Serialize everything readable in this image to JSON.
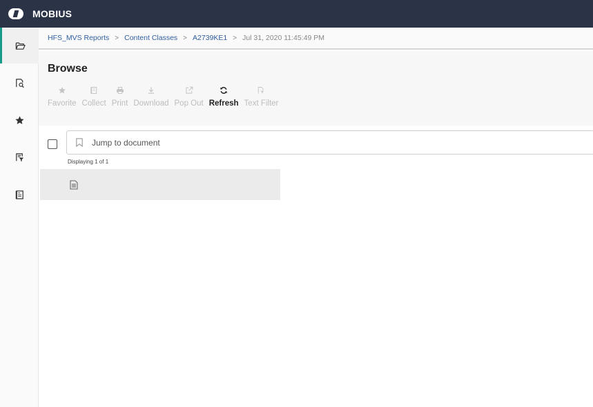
{
  "app": {
    "title": "MOBIUS"
  },
  "nav": {
    "items": [
      {
        "name": "browse",
        "icon": "folder-open-icon",
        "active": true
      },
      {
        "name": "search",
        "icon": "document-search-icon",
        "active": false
      },
      {
        "name": "favorites",
        "icon": "star-icon",
        "active": false
      },
      {
        "name": "filter",
        "icon": "document-filter-icon",
        "active": false
      },
      {
        "name": "content",
        "icon": "document-icon",
        "active": false
      }
    ]
  },
  "breadcrumb": {
    "items": [
      "HFS_MVS Reports",
      "Content Classes",
      "A2739KE1"
    ],
    "current": "Jul 31, 2020 11:45:49 PM",
    "separator": ">"
  },
  "page": {
    "title": "Browse"
  },
  "toolbar": {
    "items": [
      {
        "label": "Favorite",
        "icon": "star-icon",
        "enabled": false
      },
      {
        "label": "Collect",
        "icon": "collect-icon",
        "enabled": false
      },
      {
        "label": "Print",
        "icon": "printer-icon",
        "enabled": false
      },
      {
        "label": "Download",
        "icon": "download-icon",
        "enabled": false
      },
      {
        "label": "Pop Out",
        "icon": "pop-out-icon",
        "enabled": false
      },
      {
        "label": "Refresh",
        "icon": "refresh-icon",
        "enabled": true
      },
      {
        "label": "Text Filter",
        "icon": "text-filter-icon",
        "enabled": false
      }
    ]
  },
  "jump": {
    "placeholder": "Jump to document"
  },
  "status": {
    "displaying": "Displaying 1 of 1"
  },
  "colors": {
    "topbar": "#2b3347",
    "accent": "#169b8a",
    "link": "#2f5d9e"
  }
}
